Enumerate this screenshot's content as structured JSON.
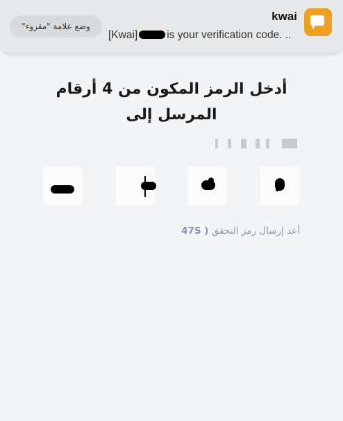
{
  "notification": {
    "app_name": "kwai",
    "message_prefix": "[Kwai]",
    "message_suffix": "is your verification code. ..",
    "mark_as_read_label": "وضع علامة \"مقروء\"",
    "icon": "kwai-app-icon",
    "accent": "#f0a020"
  },
  "main": {
    "title_line1": "أدخل الرمز المكون من 4 أرقام",
    "title_line2": "المرسل إلى",
    "code_boxes_count": 4,
    "resend_label": "أعد إرسال رمز التحقق",
    "resend_timer": "( 47S",
    "resend_color": "#8a9bb4"
  }
}
